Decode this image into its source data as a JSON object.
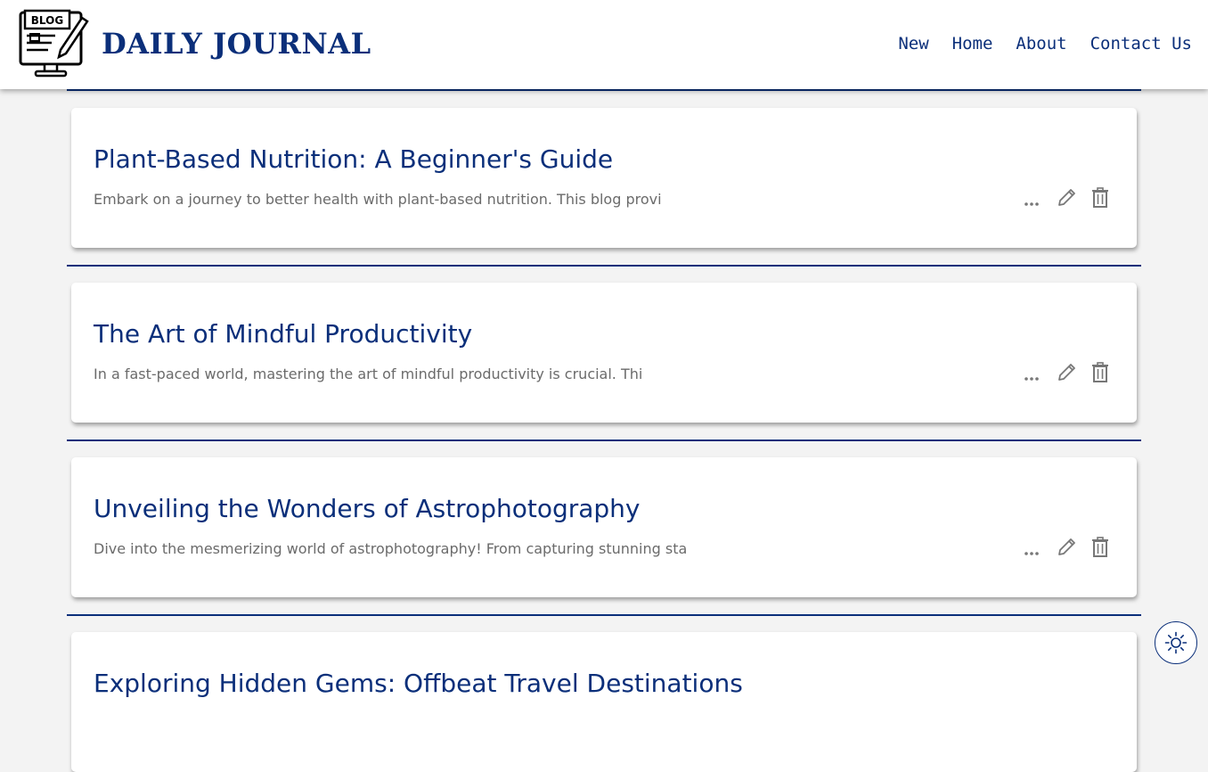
{
  "header": {
    "logo_text": "BLOG",
    "brand": "DAILY JOURNAL",
    "nav": [
      "New",
      "Home",
      "About",
      "Contact Us"
    ]
  },
  "posts": [
    {
      "title": "Plant-Based Nutrition: A Beginner's Guide",
      "excerpt": "Embark on a journey to better health with plant-based nutrition. This blog provi",
      "more_label": "..."
    },
    {
      "title": "The Art of Mindful Productivity",
      "excerpt": "In a fast-paced world, mastering the art of mindful productivity is crucial. Thi",
      "more_label": "..."
    },
    {
      "title": "Unveiling the Wonders of Astrophotography",
      "excerpt": "Dive into the mesmerizing world of astrophotography! From capturing stunning sta",
      "more_label": "..."
    },
    {
      "title": "Exploring Hidden Gems: Offbeat Travel Destinations",
      "excerpt": "",
      "more_label": "..."
    }
  ],
  "colors": {
    "brand": "#0b2f7a",
    "excerpt": "#6b6b6b",
    "icon": "#777777",
    "background": "#f3f3f3"
  },
  "icons": {
    "logo": "blog-monitor-icon",
    "more": "more-dots-icon",
    "edit": "pencil-icon",
    "delete": "trash-icon",
    "theme": "sun-icon"
  }
}
